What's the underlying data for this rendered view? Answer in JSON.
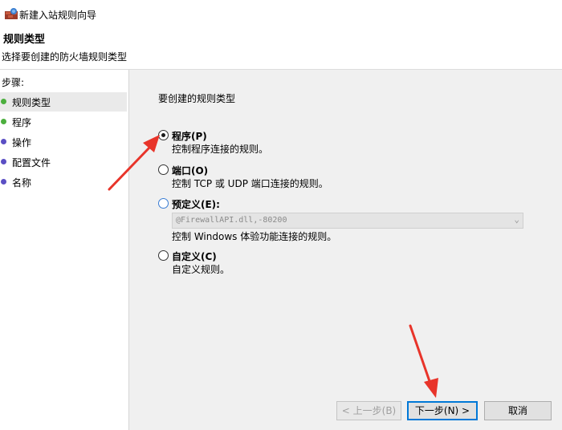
{
  "window": {
    "title": "新建入站规则向导"
  },
  "header": {
    "title": "规则类型",
    "description": "选择要创建的防火墙规则类型"
  },
  "sidebar": {
    "steps_label": "步骤:",
    "steps": [
      {
        "label": "规则类型",
        "color": "#4caf3e",
        "active": true
      },
      {
        "label": "程序",
        "color": "#4caf3e",
        "active": false
      },
      {
        "label": "操作",
        "color": "#5b4fc4",
        "active": false
      },
      {
        "label": "配置文件",
        "color": "#5b4fc4",
        "active": false
      },
      {
        "label": "名称",
        "color": "#5b4fc4",
        "active": false
      }
    ]
  },
  "main": {
    "prompt": "要创建的规则类型",
    "options": [
      {
        "label": "程序(P)",
        "desc": "控制程序连接的规则。",
        "selected": true
      },
      {
        "label": "端口(O)",
        "desc": "控制 TCP 或 UDP 端口连接的规则。",
        "selected": false
      },
      {
        "label": "预定义(E):",
        "desc": "控制 Windows 体验功能连接的规则。",
        "selected": false
      },
      {
        "label": "自定义(C)",
        "desc": "自定义规则。",
        "selected": false
      }
    ],
    "predefined_combo_value": "@FirewallAPI.dll,-80200"
  },
  "buttons": {
    "back": "< 上一步(B)",
    "next": "下一步(N) >",
    "cancel": "取消"
  },
  "colors": {
    "annotation_arrow": "#e8342a",
    "accent": "#0078d7"
  }
}
